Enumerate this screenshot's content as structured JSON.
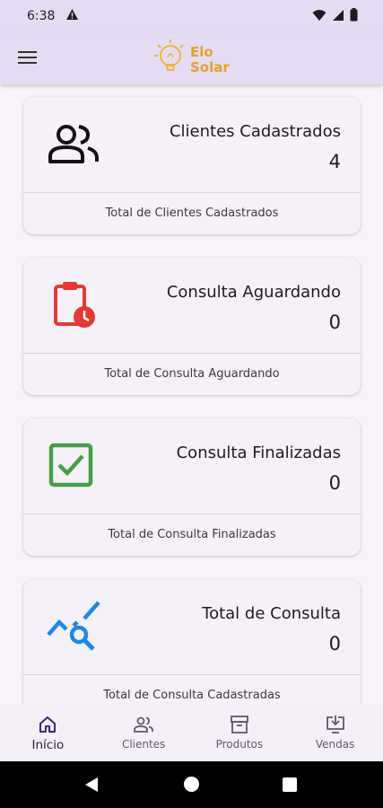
{
  "status_bar": {
    "time": "6:38"
  },
  "app_bar": {
    "logo_line1": "Elo",
    "logo_line2": "Solar"
  },
  "cards": [
    {
      "title": "Clientes Cadastrados",
      "count": "4",
      "footer": "Total de Clientes Cadastrados",
      "icon": "people-icon",
      "color": "#111111"
    },
    {
      "title": "Consulta Aguardando",
      "count": "0",
      "footer": "Total de Consulta Aguardando",
      "icon": "clipboard-clock-icon",
      "color": "#e53935"
    },
    {
      "title": "Consulta Finalizadas",
      "count": "0",
      "footer": "Total de Consulta Finalizadas",
      "icon": "checkbox-icon",
      "color": "#43a047"
    },
    {
      "title": "Total de Consulta",
      "count": "0",
      "footer": "Total de Consulta Cadastradas",
      "icon": "chart-search-icon",
      "color": "#1e88e5"
    }
  ],
  "bottom_nav": [
    {
      "label": "Início",
      "icon": "home-icon",
      "active": true
    },
    {
      "label": "Clientes",
      "icon": "people-icon",
      "active": false
    },
    {
      "label": "Produtos",
      "icon": "archive-icon",
      "active": false
    },
    {
      "label": "Vendas",
      "icon": "download-screen-icon",
      "active": false
    }
  ]
}
